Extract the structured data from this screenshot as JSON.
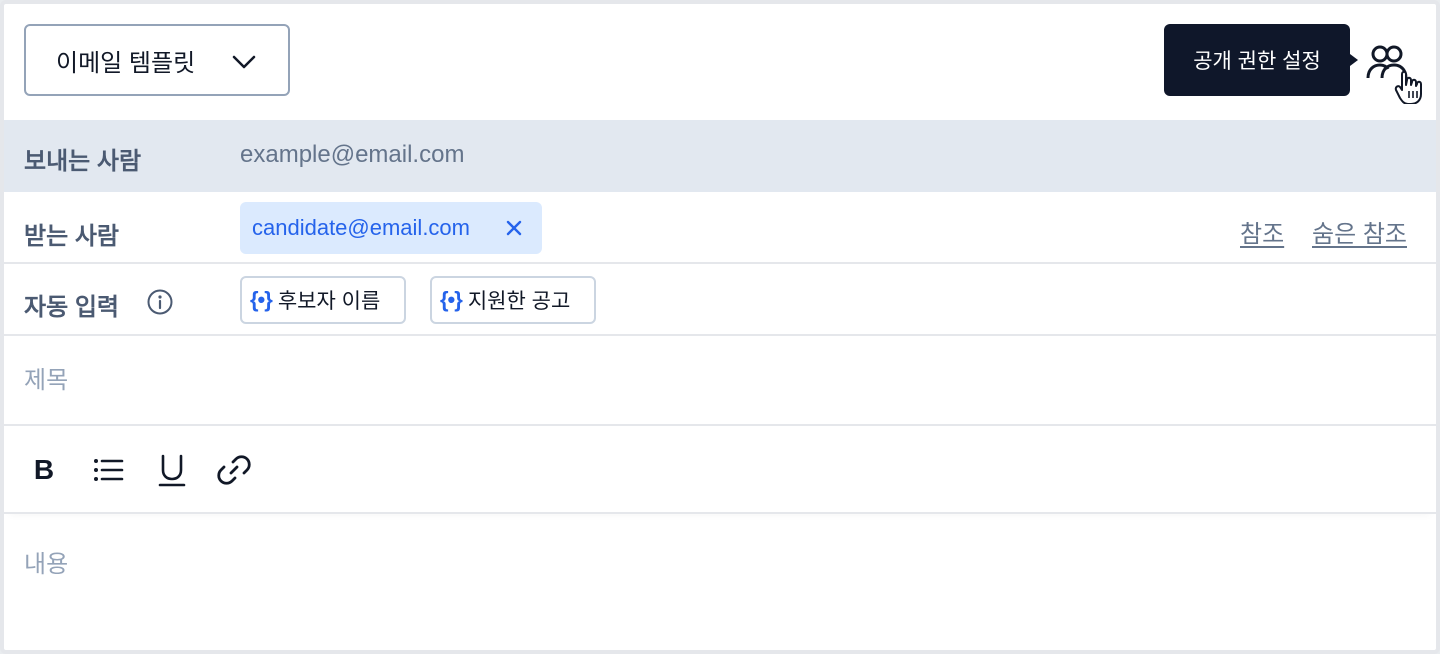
{
  "template_select": {
    "label": "이메일 템플릿"
  },
  "share": {
    "tooltip": "공개 권한 설정"
  },
  "from": {
    "label": "보내는 사람",
    "value": "example@email.com"
  },
  "to": {
    "label": "받는 사람",
    "recipients": [
      "candidate@email.com"
    ],
    "cc_label": "참조",
    "bcc_label": "숨은 참조"
  },
  "auto_fill": {
    "label": "자동 입력",
    "variables": [
      "후보자 이름",
      "지원한 공고"
    ]
  },
  "subject": {
    "placeholder": "제목"
  },
  "toolbar": {
    "bold_label": "B"
  },
  "body": {
    "placeholder": "내용"
  },
  "colors": {
    "accent": "#2563eb",
    "chip_bg": "#dbeafe",
    "tooltip_bg": "#0f172a",
    "from_row_bg": "#e2e8f0"
  }
}
